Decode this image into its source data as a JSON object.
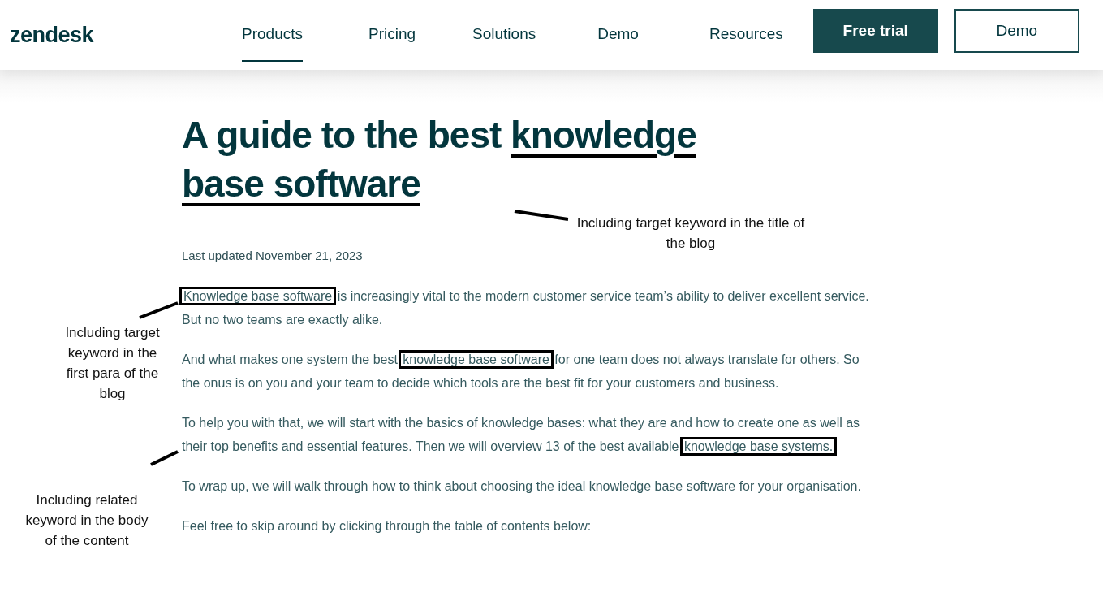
{
  "header": {
    "logo": "zendesk",
    "nav": [
      {
        "label": "Products",
        "selected": true
      },
      {
        "label": "Pricing",
        "selected": false
      },
      {
        "label": "Solutions",
        "selected": false
      },
      {
        "label": "Demo",
        "selected": false
      },
      {
        "label": "Resources",
        "selected": false
      }
    ],
    "buttons": [
      {
        "label": "Free trial",
        "kind": "primary"
      },
      {
        "label": "Demo",
        "kind": "outline"
      }
    ]
  },
  "article": {
    "title": [
      {
        "text": "A guide to the best ",
        "underlined": false
      },
      {
        "text": "knowledge base software",
        "underlined": true
      }
    ],
    "updated": "Last updated November 21, 2023",
    "paragraphs": [
      {
        "segments": [
          {
            "text": "Knowledge base software",
            "boxed": true
          },
          {
            "text": " is increasingly vital to the modern customer service team’s ability to deliver excellent service. But no two teams are exactly alike.",
            "boxed": false
          }
        ]
      },
      {
        "segments": [
          {
            "text": "And what makes one system the best ",
            "boxed": false
          },
          {
            "text": "knowledge base software",
            "boxed": true
          },
          {
            "text": " for one team does not always translate for others. So the onus is on you and your team to decide which tools are the best fit for your customers and business.",
            "boxed": false
          }
        ]
      },
      {
        "segments": [
          {
            "text": "To help you with that, we will start with the basics of knowledge bases: what they are and how to create one as well as their top benefits and essential features. Then we will overview 13 of the best available ",
            "boxed": false
          },
          {
            "text": "knowledge base systems.",
            "boxed": true
          }
        ]
      },
      {
        "segments": [
          {
            "text": "To wrap up, we will walk through how to think about choosing the ideal knowledge base software for your organisation.",
            "boxed": false
          }
        ]
      },
      {
        "segments": [
          {
            "text": "Feel free to skip around by clicking through the table of contents below:",
            "boxed": false
          }
        ]
      }
    ]
  },
  "annotations": [
    {
      "text": "Including target keyword in the title of the blog"
    },
    {
      "text": "Including target keyword in the first para of the blog"
    },
    {
      "text": "Including related keyword in the body of the content"
    }
  ]
}
